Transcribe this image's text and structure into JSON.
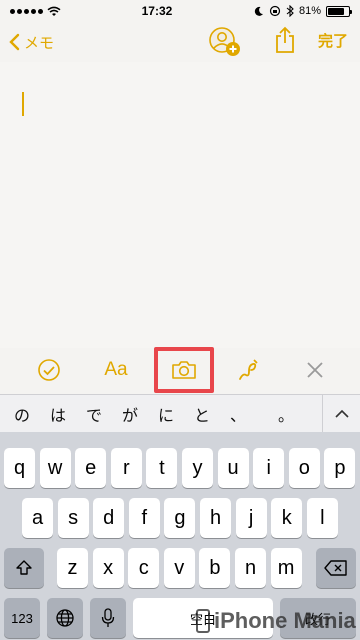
{
  "status_bar": {
    "time": "17:32",
    "battery_percent": "81%",
    "battery_level": 0.81
  },
  "nav": {
    "back_label": "メモ",
    "done_label": "完了"
  },
  "format_toolbar": {
    "aa_label": "Aa",
    "highlight_color": "#e8464b"
  },
  "candidates": [
    "の",
    "は",
    "で",
    "が",
    "に",
    "と",
    "、",
    "。"
  ],
  "keyboard": {
    "row1": [
      "q",
      "w",
      "e",
      "r",
      "t",
      "y",
      "u",
      "i",
      "o",
      "p"
    ],
    "row2": [
      "a",
      "s",
      "d",
      "f",
      "g",
      "h",
      "j",
      "k",
      "l"
    ],
    "row3": [
      "z",
      "x",
      "c",
      "v",
      "b",
      "n",
      "m"
    ],
    "num_label": "123",
    "space_label": "空白",
    "return_label": "改行"
  },
  "watermark": {
    "text": "iPhone Mania"
  },
  "colors": {
    "accent": "#e0a800",
    "keyboard_bg": "#d1d4da"
  }
}
